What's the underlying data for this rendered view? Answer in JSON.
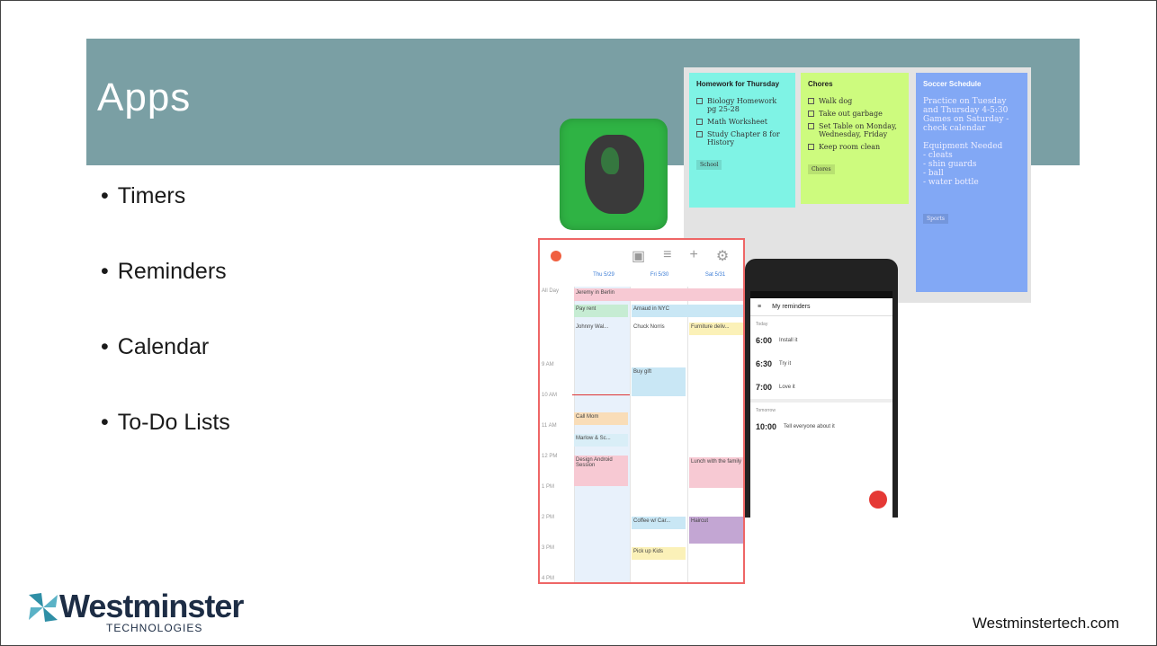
{
  "slide": {
    "title": "Apps",
    "bullets": [
      "Timers",
      "Reminders",
      "Calendar",
      "To-Do Lists"
    ],
    "url": "Westminstertech.com"
  },
  "logo": {
    "word": "Westminster",
    "sub": "TECHNOLOGIES"
  },
  "notes": {
    "n1": {
      "title": "Homework for Thursday",
      "items": [
        "Biology Homework pg 25-28",
        "Math Worksheet",
        "Study Chapter 8 for History"
      ],
      "tag": "School"
    },
    "n2": {
      "title": "Chores",
      "items": [
        "Walk dog",
        "Take out garbage",
        "Set Table on Monday, Wednesday, Friday",
        "Keep room clean"
      ],
      "tag": "Chores"
    },
    "n3": {
      "title": "Soccer Schedule",
      "lines": [
        "Practice on Tuesday and Thursday 4-5:30",
        "Games on Saturday - check calendar",
        "",
        "Equipment Needed",
        "- cleats",
        "- shin guards",
        "- ball",
        "- water bottle"
      ],
      "tag": "Sports"
    }
  },
  "calendar": {
    "days": [
      "Thu 5/29",
      "Fri 5/30",
      "Sat 5/31"
    ],
    "allday": "All Day",
    "hours": [
      "9 AM",
      "10 AM",
      "11 AM",
      "12 PM",
      "1 PM",
      "2 PM",
      "3 PM",
      "4 PM"
    ],
    "events": {
      "berlin": "Jeremy in Berlin",
      "rent": "Pay rent",
      "nyc": "Arnaud in NYC",
      "johnny": "Johnny Wal...",
      "chuck": "Chuck Norris",
      "furniture": "Furniture deliv...",
      "gift": "Buy gift",
      "mom": "Call Mom",
      "marlow": "Marlow & Sc...",
      "design": "Design Android Session",
      "lunch": "Lunch with the family",
      "coffee": "Coffee w/ Car...",
      "haircut": "Haircut",
      "kids": "Pick up Kids"
    }
  },
  "phone": {
    "header": "My reminders",
    "today": "Today",
    "tomorrow": "Tomorrow",
    "items": [
      {
        "time": "6:00",
        "label": "Install it"
      },
      {
        "time": "6:30",
        "label": "Try it"
      },
      {
        "time": "7:00",
        "label": "Love it"
      }
    ],
    "tomorrow_item": {
      "time": "10:00",
      "label": "Tell everyone about it"
    }
  }
}
